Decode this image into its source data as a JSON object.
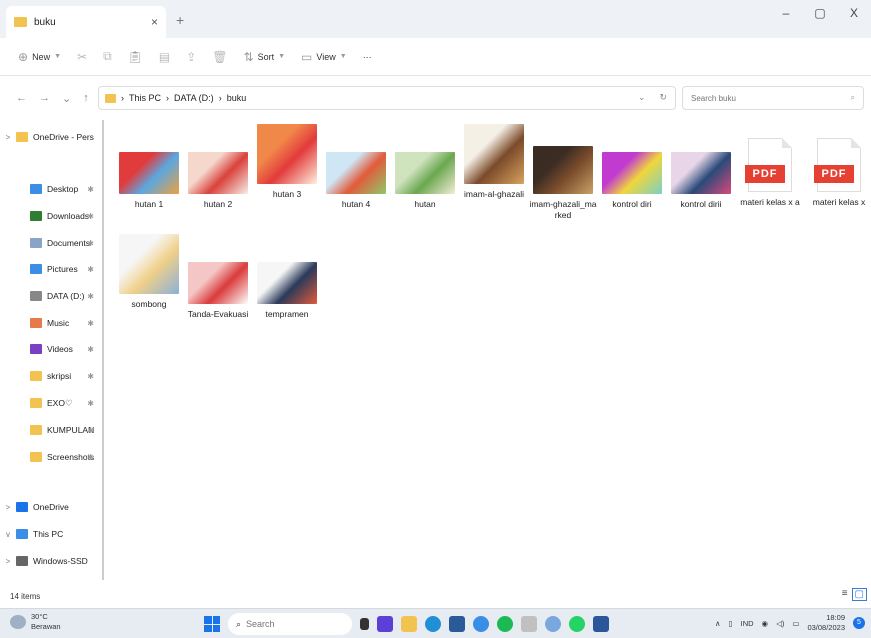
{
  "titlebar": {
    "tab_label": "buku",
    "tab_close": "×",
    "new_tab": "+",
    "minimize": "–",
    "maximize": "▢",
    "close": "X"
  },
  "toolbar": {
    "new_label": "New",
    "sort_label": "Sort",
    "view_label": "View",
    "more_label": "···"
  },
  "address": {
    "breadcrumb": [
      "This PC",
      "DATA (D:)",
      "buku"
    ],
    "search_placeholder": "Search buku"
  },
  "sidebar": {
    "items": [
      {
        "label": "OneDrive - Pers",
        "color": "#f2c350",
        "chev": ">"
      },
      {
        "label": "Desktop",
        "color": "#3a8ee6",
        "pin": true
      },
      {
        "label": "Downloads",
        "color": "#2e7d32",
        "pin": true
      },
      {
        "label": "Documents",
        "color": "#8aa4c8",
        "pin": true
      },
      {
        "label": "Pictures",
        "color": "#3a8ee6",
        "pin": true
      },
      {
        "label": "DATA (D:)",
        "color": "#888888",
        "pin": true
      },
      {
        "label": "Music",
        "color": "#e8794a",
        "pin": true
      },
      {
        "label": "Videos",
        "color": "#7b3fc4",
        "pin": true
      },
      {
        "label": "skripsi",
        "color": "#f2c350",
        "pin": true
      },
      {
        "label": "EXO♡",
        "color": "#f2c350",
        "pin": true
      },
      {
        "label": "KUMPULAN",
        "color": "#f2c350",
        "pin": true
      },
      {
        "label": "Screenshots",
        "color": "#f2c350",
        "pin": true
      },
      {
        "label": "OneDrive",
        "color": "#1a73e8",
        "chev": ">"
      },
      {
        "label": "This PC",
        "color": "#3a8ee6",
        "chev": "v"
      },
      {
        "label": "Windows-SSD",
        "color": "#666666",
        "chev": ">"
      }
    ]
  },
  "files": [
    {
      "name": "hutan 1",
      "kind": "image",
      "colors": [
        "#e23b3b",
        "#5ba7e0",
        "#f0a040"
      ]
    },
    {
      "name": "hutan 2",
      "kind": "image",
      "colors": [
        "#f5d7cc",
        "#d9413a",
        "#f5f0ea"
      ]
    },
    {
      "name": "hutan 3",
      "kind": "image",
      "colors": [
        "#f0884a",
        "#e23b3b",
        "#fff0e0"
      ]
    },
    {
      "name": "hutan 4",
      "kind": "image",
      "colors": [
        "#cfe6f5",
        "#e25a3b",
        "#8ec96a"
      ]
    },
    {
      "name": "hutan",
      "kind": "image",
      "colors": [
        "#cfe3bf",
        "#6aa84f",
        "#f5ecd6"
      ]
    },
    {
      "name": "imam-al-ghazali",
      "kind": "image",
      "colors": [
        "#f4f0e6",
        "#7b4a2a",
        "#d9a35e"
      ]
    },
    {
      "name": "imam-ghazali_marked",
      "kind": "image",
      "colors": [
        "#3a2c22",
        "#7a4b2c",
        "#c9a267"
      ]
    },
    {
      "name": "kontrol diri",
      "kind": "image",
      "colors": [
        "#c23bd0",
        "#f0d63b",
        "#7ad0c8"
      ]
    },
    {
      "name": "kontrol dirii",
      "kind": "image",
      "colors": [
        "#e8d6e8",
        "#2a4a7a",
        "#d94a7a"
      ]
    },
    {
      "name": "materi kelas x a",
      "kind": "pdf"
    },
    {
      "name": "materi kelas x",
      "kind": "pdf"
    },
    {
      "name": "sombong",
      "kind": "image",
      "colors": [
        "#f6f6f6",
        "#f0d08a",
        "#8ab0d9"
      ]
    },
    {
      "name": "Tanda-Evakuasi",
      "kind": "image",
      "colors": [
        "#f5c6c6",
        "#d93a3a",
        "#ffffff"
      ]
    },
    {
      "name": "tempramen",
      "kind": "image",
      "colors": [
        "#f6f6f6",
        "#2a3a5a",
        "#e25a3b"
      ]
    }
  ],
  "pdf_badge": "PDF",
  "status": {
    "item_count": "14 items"
  },
  "taskbar": {
    "temperature": "30°C",
    "weather": "Berawan",
    "search_placeholder": "Search",
    "language": "IND",
    "time": "18:09",
    "date": "03/08/2023",
    "notification_count": "5"
  }
}
